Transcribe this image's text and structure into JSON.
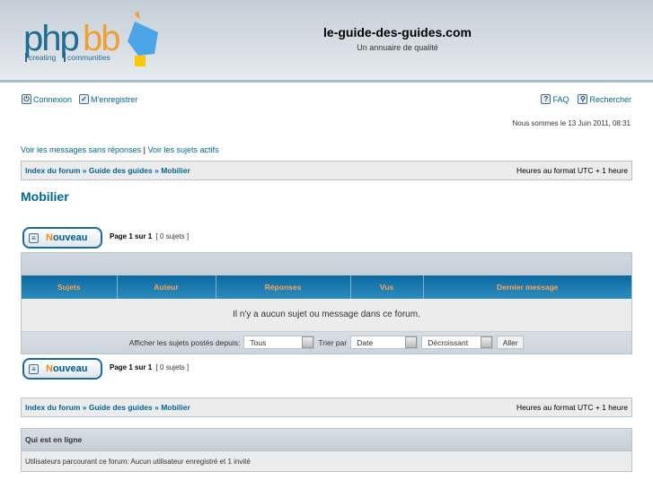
{
  "header": {
    "logo_text": "phpBB creating communities",
    "title": "le-guide-des-guides.com",
    "subtitle": "Un annuaire de qualité"
  },
  "nav": {
    "login": "Connexion",
    "register": "M'enregistrer",
    "faq": "FAQ",
    "search": "Rechercher"
  },
  "date": "Nous sommes le 13 Juin 2011, 08:31",
  "links": {
    "unanswered": "Voir les messages sans réponses",
    "sep": "|",
    "active": "Voir les sujets actifs"
  },
  "breadcrumb": {
    "index": "Index du forum",
    "sep": "»",
    "guide": "Guide des guides",
    "current": "Mobilier",
    "timezone": "Heures au format UTC + 1 heure"
  },
  "page_title": "Mobilier",
  "new_button": {
    "first": "N",
    "rest": "ouveau"
  },
  "pagination": {
    "page": "Page 1 sur 1",
    "count": "[ 0 sujets ]"
  },
  "table": {
    "columns": [
      "Sujets",
      "Auteur",
      "Réponses",
      "Vus",
      "Dernier message"
    ],
    "empty": "Il n'y a aucun sujet ou message dans ce forum."
  },
  "filters": {
    "show_label": "Afficher les sujets postés depuis:",
    "show_value": "Tous",
    "sort_label": "Trier par",
    "sort_value": "Date",
    "order_value": "Décroissant",
    "go": "Aller"
  },
  "online": {
    "title": "Qui est en ligne",
    "text": "Utilisateurs parcourant ce forum: Aucun utilisateur enregistré et 1 invité"
  }
}
